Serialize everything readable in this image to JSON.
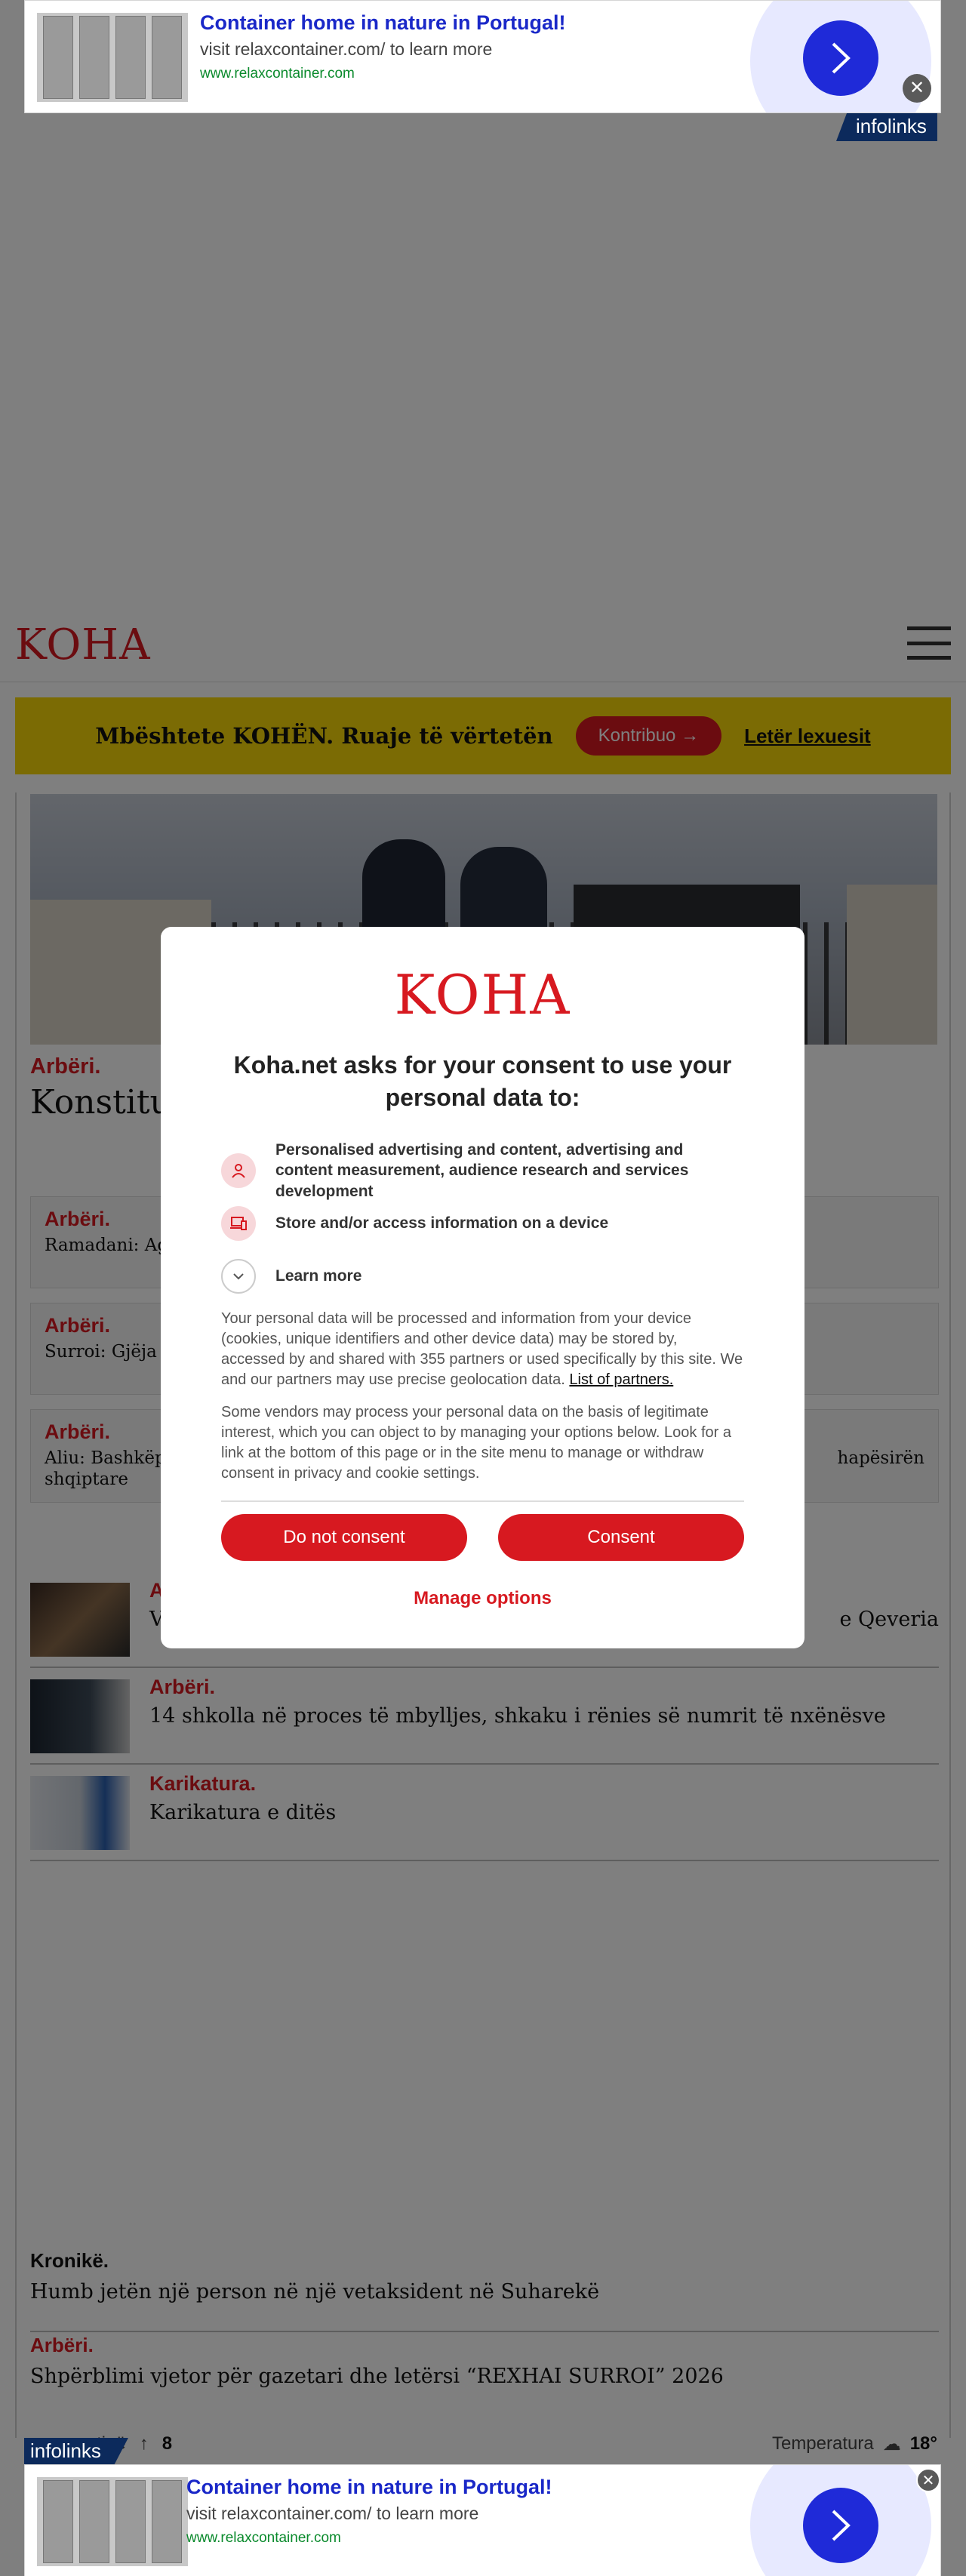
{
  "ad": {
    "headline": "Container home in nature in Portugal!",
    "description": "visit relaxcontainer.com/ to learn more",
    "url": "www.relaxcontainer.com",
    "close": "✕",
    "network": "infolinks"
  },
  "site": {
    "logo": "KOHA"
  },
  "support": {
    "text": "Mbështete KOHËN. Ruaje të vërtetën",
    "button": "Kontribuo",
    "link": "Letër lexuesit"
  },
  "hero": {
    "category": "Arbëri.",
    "title": "Konstitui"
  },
  "related": [
    {
      "category": "Arbëri.",
      "text": "Ramadani: Ag"
    },
    {
      "category": "Arbëri.",
      "text": "Surroi: Gjëja s"
    },
    {
      "category": "Arbëri.",
      "text_left": "Aliu: Bashkëp",
      "text_right": "hapësirën",
      "text_line2": "shqiptare"
    }
  ],
  "stories": [
    {
      "category": "A",
      "title_left": "V",
      "title_right": "e Qeveria"
    },
    {
      "category": "Arbëri.",
      "title": "14 shkolla në proces të mbylljes, shkaku i rënies së numrit të nxënësve"
    },
    {
      "category": "Karikatura.",
      "title": "Karikatura e ditës"
    }
  ],
  "news": [
    {
      "category": "Kronikë.",
      "title": "Humb jetën një person në një vetaksident në Suharekë"
    },
    {
      "category": "Arbëri.",
      "title": "Shpërblimi vjetor për gazetari dhe letërsi “REXHAI SURROI” 2026"
    }
  ],
  "footer": {
    "left_label": "tinë",
    "count": "8",
    "temp_label": "Temperatura",
    "temp_value": "18°"
  },
  "consent": {
    "logo": "KOHA",
    "title": "Koha.net asks for your consent to use your personal data to:",
    "purposes": [
      {
        "icon": "person-icon",
        "text": "Personalised advertising and content, advertising and content measurement, audience research and services development"
      },
      {
        "icon": "device-icon",
        "text": "Store and/or access information on a device"
      }
    ],
    "learn_more": "Learn more",
    "paragraph1": "Your personal data will be processed and information from your device (cookies, unique identifiers and other device data) may be stored by, accessed by and shared with 355 partners or used specifically by this site. We and our partners may use precise geolocation data.",
    "partners_link": "List of partners.",
    "paragraph2": "Some vendors may process your personal data on the basis of legitimate interest, which you can object to by managing your options below. Look for a link at the bottom of this page or in the site menu to manage or withdraw consent in privacy and cookie settings.",
    "btn_do_not_consent": "Do not consent",
    "btn_consent": "Consent",
    "manage": "Manage options"
  },
  "colors": {
    "brand_red": "#d71920",
    "support_yellow": "#f7d708",
    "ad_blue": "#1f2ad8"
  }
}
